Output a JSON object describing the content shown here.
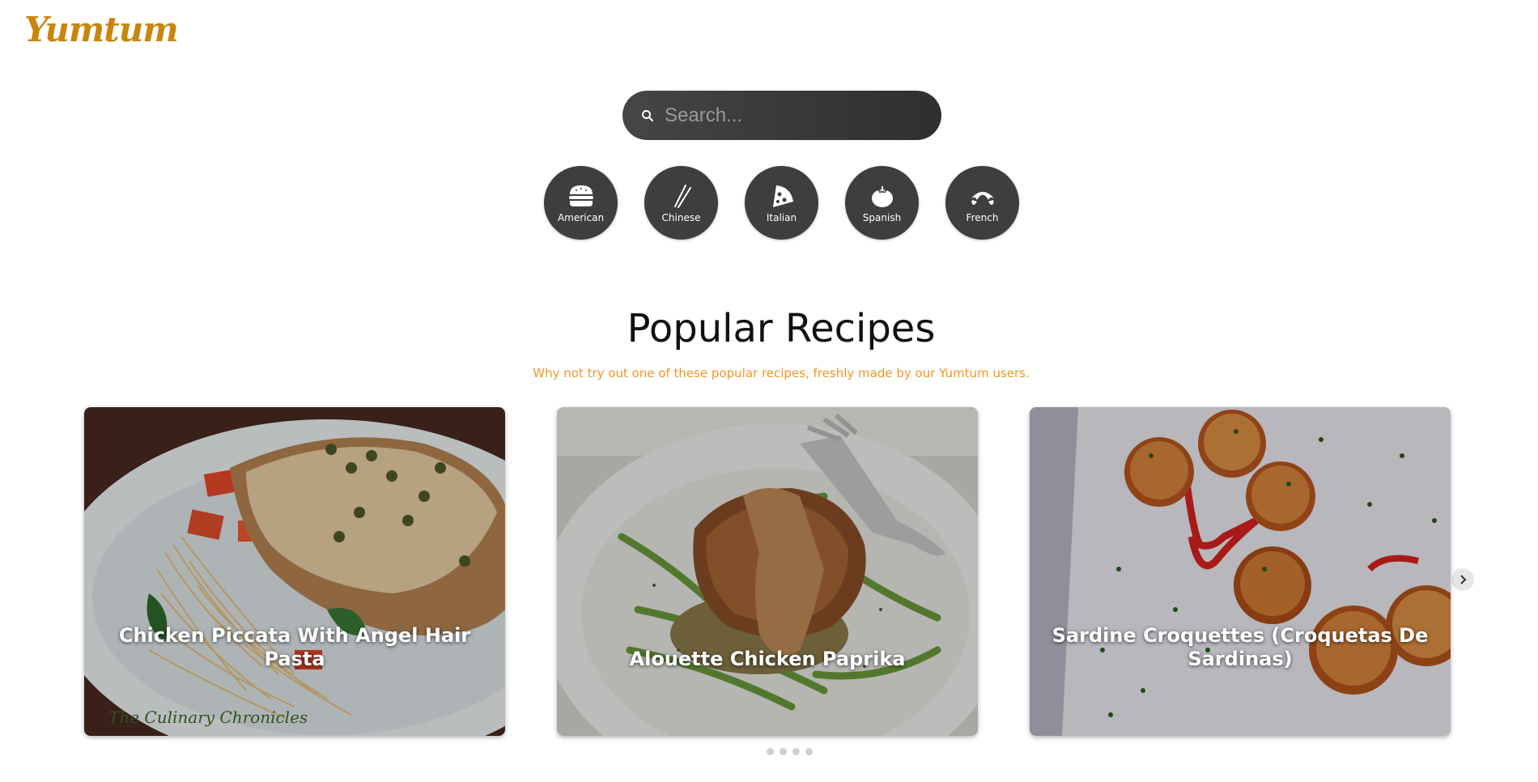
{
  "brand": {
    "logo_text": "Yumtum",
    "color": "#c8860c"
  },
  "search": {
    "placeholder": "Search...",
    "value": "",
    "icon": "search-icon"
  },
  "cuisines": [
    {
      "label": "American",
      "icon": "burger-icon"
    },
    {
      "label": "Chinese",
      "icon": "chopsticks-icon"
    },
    {
      "label": "Italian",
      "icon": "pizza-icon"
    },
    {
      "label": "Spanish",
      "icon": "tomato-icon"
    },
    {
      "label": "French",
      "icon": "croissant-icon"
    }
  ],
  "popular": {
    "title": "Popular Recipes",
    "subtitle": "Why not try out one of these popular recipes, freshly made by our Yumtum users.",
    "subtitle_color": "#f0952a",
    "recipes": [
      {
        "title": "Chicken Piccata With Angel Hair Pasta",
        "watermark": "The Culinary Chronicles"
      },
      {
        "title": "Alouette Chicken Paprika"
      },
      {
        "title": "Sardine Croquettes (Croquetas De Sardinas)"
      }
    ],
    "carousel": {
      "prev_icon": "chevron-left-icon",
      "next_icon": "chevron-right-icon",
      "page_count": 4
    }
  }
}
